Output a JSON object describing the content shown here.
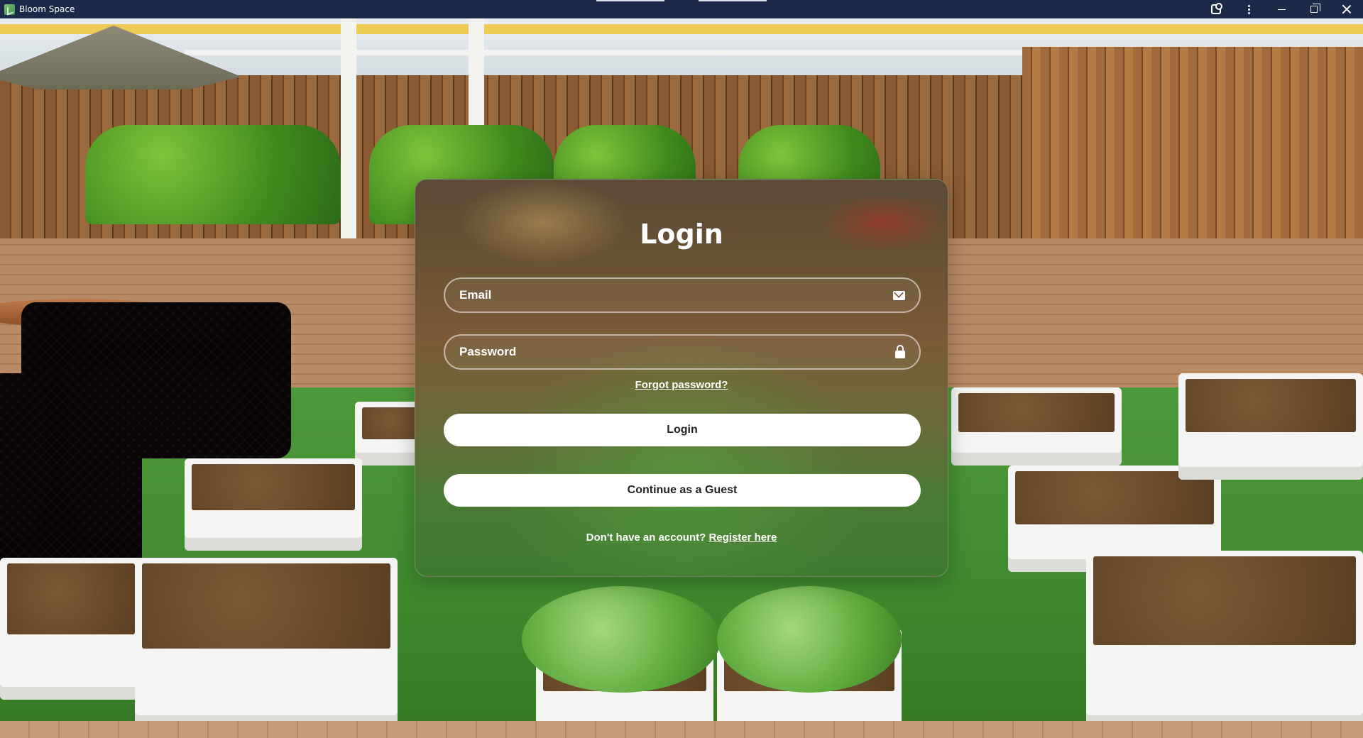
{
  "window": {
    "title": "Bloom Space",
    "icons": [
      "app-icon",
      "extensions-icon",
      "more-options-icon",
      "minimize-icon",
      "restore-icon",
      "close-icon"
    ]
  },
  "login": {
    "heading": "Login",
    "email_placeholder": "Email",
    "email_value": "",
    "email_icon": "mail-icon",
    "password_placeholder": "Password",
    "password_value": "",
    "password_icon": "lock-icon",
    "forgot_password": "Forgot password?",
    "login_button": "Login",
    "guest_button": "Continue as a Guest",
    "register_prompt": "Don't have an account?",
    "register_link": "Register here"
  },
  "colors": {
    "titlebar": "#1c2a4a",
    "button_bg": "#ffffff",
    "text_light": "#ffffff"
  }
}
